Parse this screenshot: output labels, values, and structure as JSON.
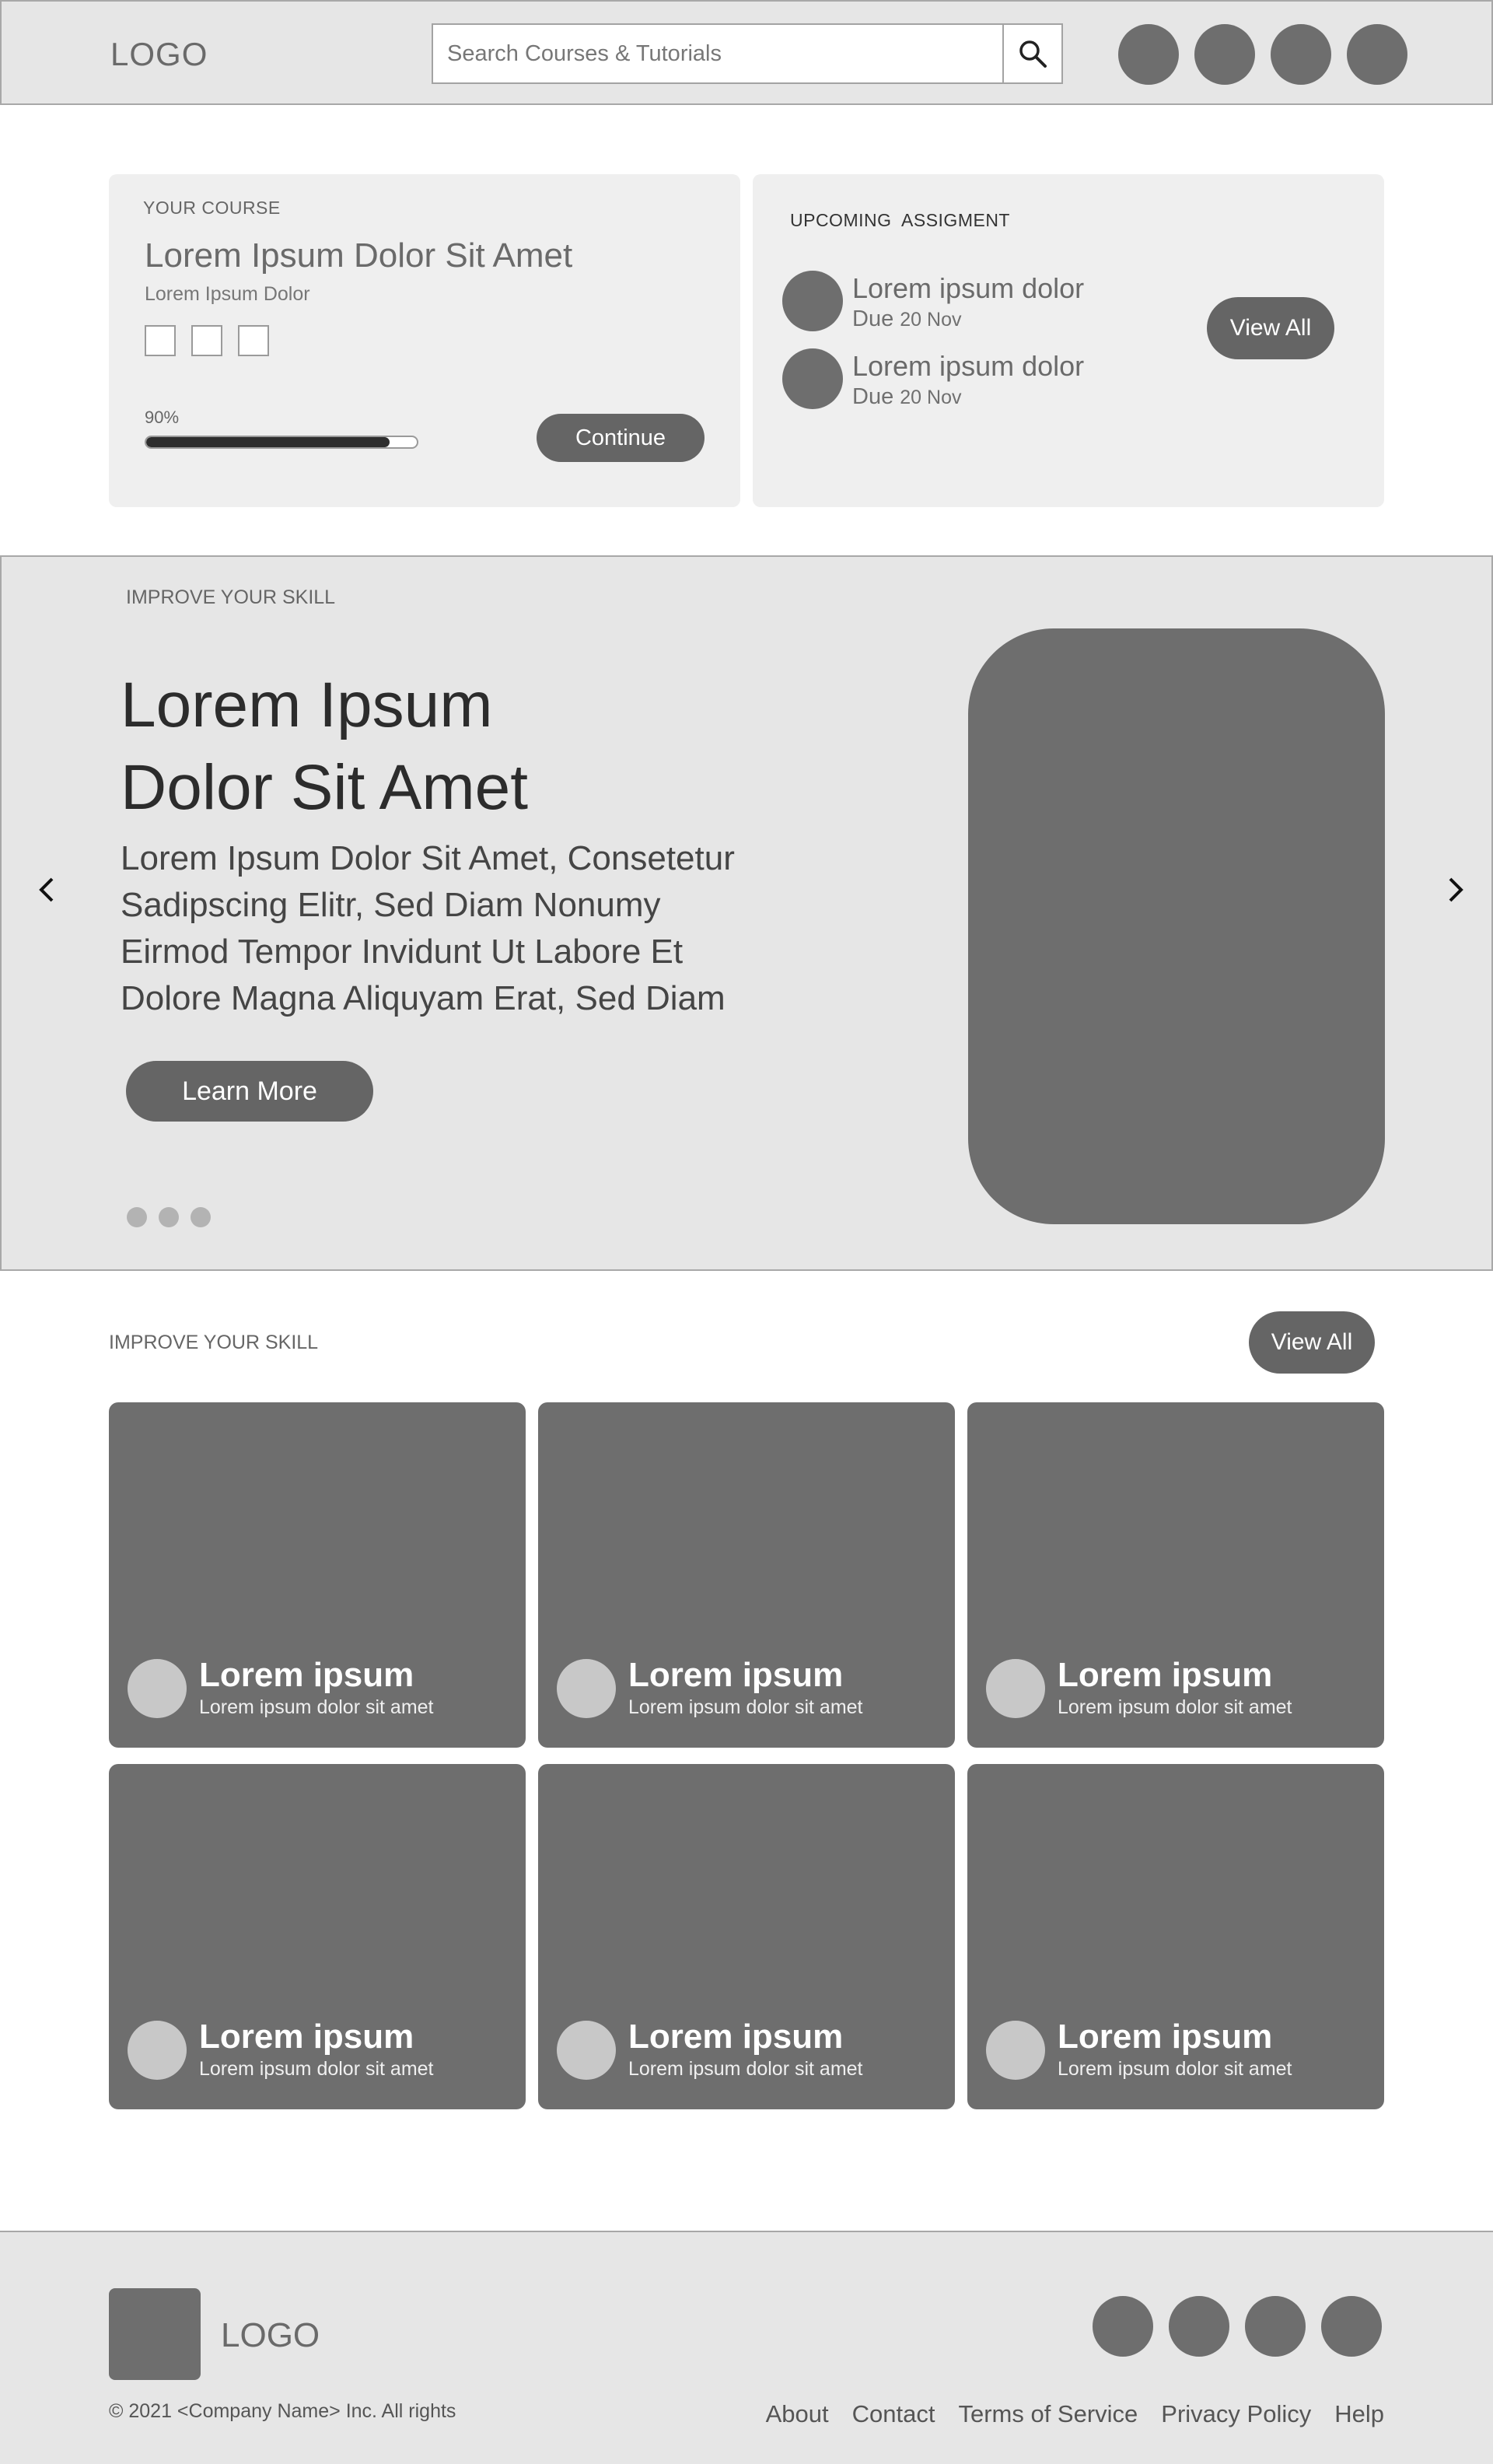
{
  "header": {
    "logo": "LOGO",
    "search_placeholder": "Search Courses & Tutorials"
  },
  "course_card": {
    "kicker": "YOUR COURSE",
    "title": "Lorem Ipsum Dolor Sit Amet",
    "subtitle": "Lorem Ipsum Dolor",
    "progress_label": "90%",
    "progress_value": 0.9,
    "continue_label": "Continue"
  },
  "assignments": {
    "kicker": "UPCOMING  ASSIGMENT",
    "view_all_label": "View All",
    "items": [
      {
        "name": "Lorem ipsum dolor",
        "due_prefix": "Due",
        "due_date": "20 Nov"
      },
      {
        "name": "Lorem ipsum dolor",
        "due_prefix": "Due",
        "due_date": "20 Nov"
      }
    ]
  },
  "hero": {
    "kicker": "IMPROVE YOUR SKILL",
    "title_line1": "Lorem Ipsum",
    "title_line2": "Dolor Sit Amet",
    "body_lines": [
      "Lorem Ipsum Dolor Sit Amet, Consetetur",
      "Sadipscing Elitr, Sed Diam Nonumy",
      "Eirmod Tempor Invidunt Ut Labore Et",
      "Dolore Magna Aliquyam Erat, Sed Diam"
    ],
    "cta_label": "Learn More"
  },
  "skills": {
    "kicker": "IMPROVE YOUR SKILL",
    "view_all_label": "View All",
    "tiles": [
      {
        "title": "Lorem ipsum",
        "subtitle": "Lorem ipsum dolor sit amet"
      },
      {
        "title": "Lorem ipsum",
        "subtitle": "Lorem ipsum dolor sit amet"
      },
      {
        "title": "Lorem ipsum",
        "subtitle": "Lorem ipsum dolor sit amet"
      },
      {
        "title": "Lorem ipsum",
        "subtitle": "Lorem ipsum dolor sit amet"
      },
      {
        "title": "Lorem ipsum",
        "subtitle": "Lorem ipsum dolor sit amet"
      },
      {
        "title": "Lorem ipsum",
        "subtitle": "Lorem ipsum dolor sit amet"
      }
    ]
  },
  "footer": {
    "logo": "LOGO",
    "copyright": "© 2021 <Company Name> Inc. All rights",
    "links": [
      "About",
      "Contact",
      "Terms of Service",
      "Privacy Policy",
      "Help"
    ]
  },
  "colors": {
    "placeholder_gray": "#6e6e6e",
    "panel_gray": "#e6e6e6",
    "button_gray": "#656565"
  }
}
